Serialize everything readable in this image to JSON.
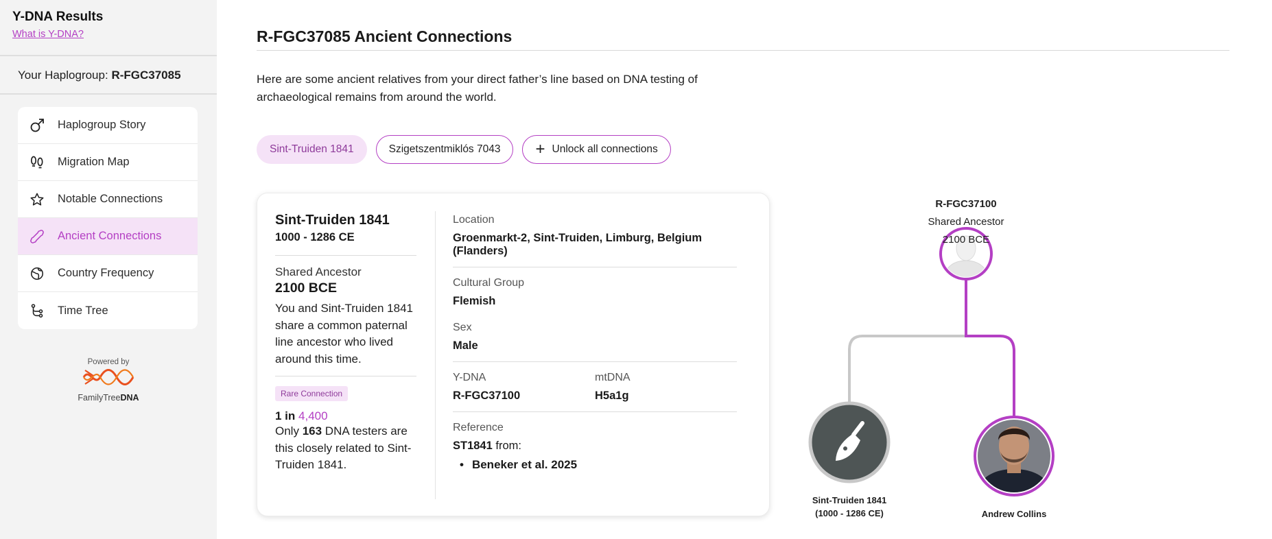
{
  "sidebar": {
    "title": "Y-DNA Results",
    "what_is_link": "What is Y-DNA?",
    "haplogroup_label": "Your Haplogroup:",
    "haplogroup_value": "R-FGC37085",
    "nav": [
      {
        "label": "Haplogroup Story",
        "icon": "male-symbol-icon",
        "active": false
      },
      {
        "label": "Migration Map",
        "icon": "footprints-icon",
        "active": false
      },
      {
        "label": "Notable Connections",
        "icon": "star-icon",
        "active": false
      },
      {
        "label": "Ancient Connections",
        "icon": "bone-icon",
        "active": true
      },
      {
        "label": "Country Frequency",
        "icon": "globe-icon",
        "active": false
      },
      {
        "label": "Time Tree",
        "icon": "tree-branch-icon",
        "active": false
      }
    ],
    "powered_by": "Powered by",
    "brand_left": "FamilyTree",
    "brand_right": "DNA"
  },
  "main": {
    "title": "R-FGC37085 Ancient Connections",
    "intro": "Here are some ancient relatives from your direct father’s line based on DNA testing of archaeological remains from around the world.",
    "chips": [
      {
        "label": "Sint-Truiden 1841",
        "active": true
      },
      {
        "label": "Szigetszentmiklós 7043",
        "active": false
      },
      {
        "label": "Unlock all connections",
        "icon": "plus-icon",
        "active": false
      }
    ]
  },
  "card": {
    "name": "Sint-Truiden 1841",
    "date_range": "1000 - 1286 CE",
    "shared_ancestor_label": "Shared Ancestor",
    "shared_ancestor_value": "2100 BCE",
    "shared_desc": "You and Sint-Truiden 1841 share a common paternal line ancestor who lived around this time.",
    "badge": "Rare Connection",
    "odds_prefix": "1 in ",
    "odds_value": "4,400",
    "testers_pre": "Only ",
    "testers_count": "163",
    "testers_post": " DNA testers are this closely related to Sint-Truiden 1841.",
    "location_label": "Location",
    "location_value": "Groenmarkt-2, Sint-Truiden, Limburg, Belgium (Flanders)",
    "cultural_label": "Cultural Group",
    "cultural_value": "Flemish",
    "sex_label": "Sex",
    "sex_value": "Male",
    "ydna_label": "Y-DNA",
    "ydna_value": "R-FGC37100",
    "mtdna_label": "mtDNA",
    "mtdna_value": "H5a1g",
    "reference_label": "Reference",
    "reference_id": "ST1841",
    "reference_from": " from:",
    "reference_item": "Beneker et al. 2025"
  },
  "tree": {
    "ancestor_haplogroup": "R-FGC37100",
    "ancestor_label": "Shared Ancestor",
    "ancestor_date": "2100 BCE",
    "ancient_name": "Sint-Truiden 1841",
    "ancient_dates": "(1000 - 1286 CE)",
    "user_name": "Andrew Collins"
  },
  "colors": {
    "accent": "#b43fc4",
    "accent_light": "#f5e2f7",
    "line_gray": "#c8c8c8",
    "node_dark": "#4e5555"
  }
}
